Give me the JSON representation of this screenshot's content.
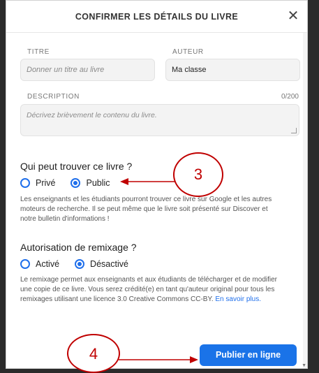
{
  "dialog": {
    "title": "CONFIRMER LES DÉTAILS DU LIVRE",
    "close_symbol": "✕"
  },
  "form": {
    "title_label": "TITRE",
    "title_placeholder": "Donner un titre au livre",
    "author_label": "AUTEUR",
    "author_value": "Ma classe",
    "description_label": "DESCRIPTION",
    "description_counter": "0/200",
    "description_placeholder": "Décrivez brièvement le contenu du livre."
  },
  "visibility": {
    "heading": "Qui peut trouver ce livre ?",
    "options": [
      {
        "label": "Privé",
        "checked": false
      },
      {
        "label": "Public",
        "checked": true
      }
    ],
    "help": "Les enseignants et les étudiants pourront trouver ce livre sur Google et les autres moteurs de recherche. Il se peut même que le livre soit présenté sur Discover et notre bulletin d'informations !"
  },
  "remix": {
    "heading": "Autorisation de remixage ?",
    "options": [
      {
        "label": "Activé",
        "checked": false
      },
      {
        "label": "Désactivé",
        "checked": true
      }
    ],
    "help": "Le remixage permet aux enseignants et aux étudiants de télécharger et de modifier une copie de ce livre. Vous serez crédité(e) en tant qu'auteur original pour tous les remixages utilisant une licence 3.0 Creative Commons CC-BY.",
    "learn_more": "En savoir plus."
  },
  "publish_button": "Publier en ligne",
  "annotations": {
    "step3": "3",
    "step4": "4",
    "color": "#c00000"
  },
  "colors": {
    "accent": "#1a73e8",
    "annotation": "#c00000"
  }
}
